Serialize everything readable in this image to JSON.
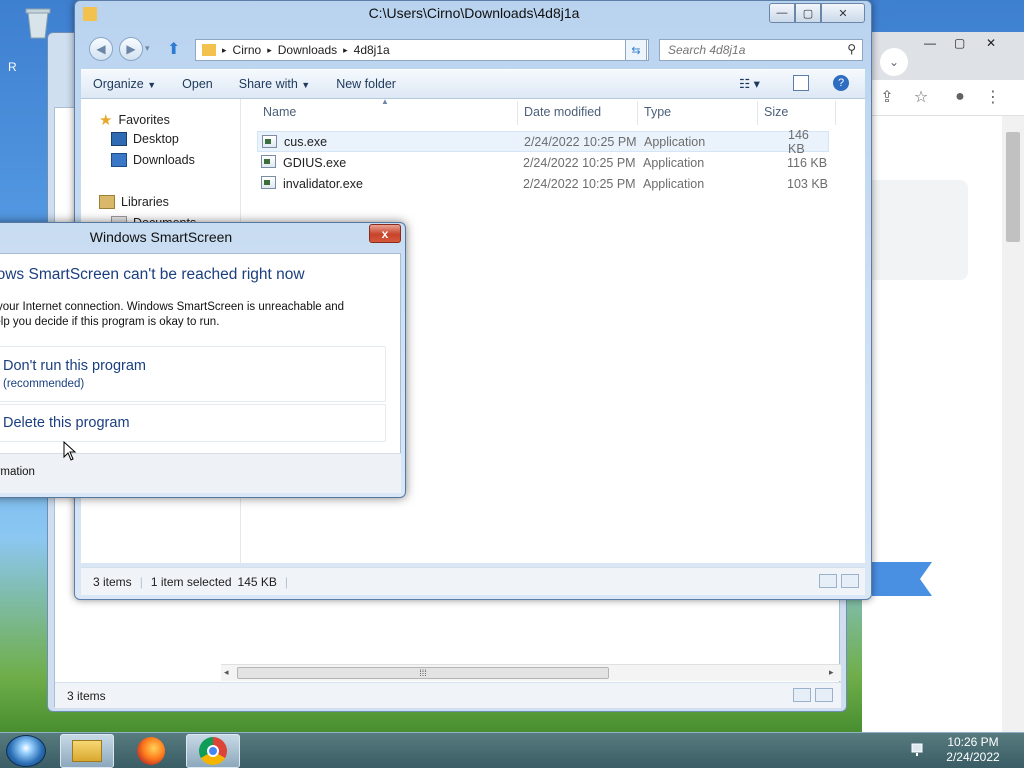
{
  "desktop": {
    "recycle_bin_icon": "recycle-bin-icon",
    "side_letter": "R"
  },
  "chrome": {
    "icons": [
      "chevron-down-icon",
      "share-icon",
      "star-icon",
      "profile-icon",
      "more-vert-icon"
    ],
    "banner_color": "#4a90e2"
  },
  "back_explorer": {
    "status_items": "3 items"
  },
  "explorer": {
    "window_title": "C:\\Users\\Cirno\\Downloads\\4d8j1a",
    "breadcrumb": [
      "Cirno",
      "Downloads",
      "4d8j1a"
    ],
    "search_placeholder": "Search 4d8j1a",
    "toolbar": {
      "organize": "Organize",
      "open": "Open",
      "share_with": "Share with",
      "new_folder": "New folder"
    },
    "nav": {
      "favorites": "Favorites",
      "desktop": "Desktop",
      "downloads": "Downloads",
      "libraries": "Libraries",
      "documents_partial": "Documents"
    },
    "columns": {
      "name": "Name",
      "date_modified": "Date modified",
      "type": "Type",
      "size": "Size"
    },
    "files": [
      {
        "name": "cus.exe",
        "date": "2/24/2022 10:25 PM",
        "type": "Application",
        "size": "146 KB"
      },
      {
        "name": "GDIUS.exe",
        "date": "2/24/2022 10:25 PM",
        "type": "Application",
        "size": "116 KB"
      },
      {
        "name": "invalidator.exe",
        "date": "2/24/2022 10:25 PM",
        "type": "Application",
        "size": "103 KB"
      }
    ],
    "status": {
      "items": "3 items",
      "selected": "1 item selected",
      "selected_size": "145 KB"
    }
  },
  "smartscreen": {
    "title": "Windows SmartScreen",
    "heading": "dows SmartScreen can't be reached right now",
    "description_line1": "k your Internet connection. Windows SmartScreen is unreachable and",
    "description_line2": "help you decide if this program is okay to run.",
    "option1": "Don't run this program",
    "option1_sub": "(recommended)",
    "option2": "Delete this program",
    "more_info": "formation",
    "close_label": "x"
  },
  "taskbar": {
    "time": "10:26 PM",
    "date": "2/24/2022",
    "apps": [
      "explorer-icon",
      "firefox-icon",
      "chrome-icon"
    ]
  },
  "colors": {
    "link_blue": "#1b3f80",
    "close_red": "#c7432a",
    "selection": "#eaf3fc"
  }
}
